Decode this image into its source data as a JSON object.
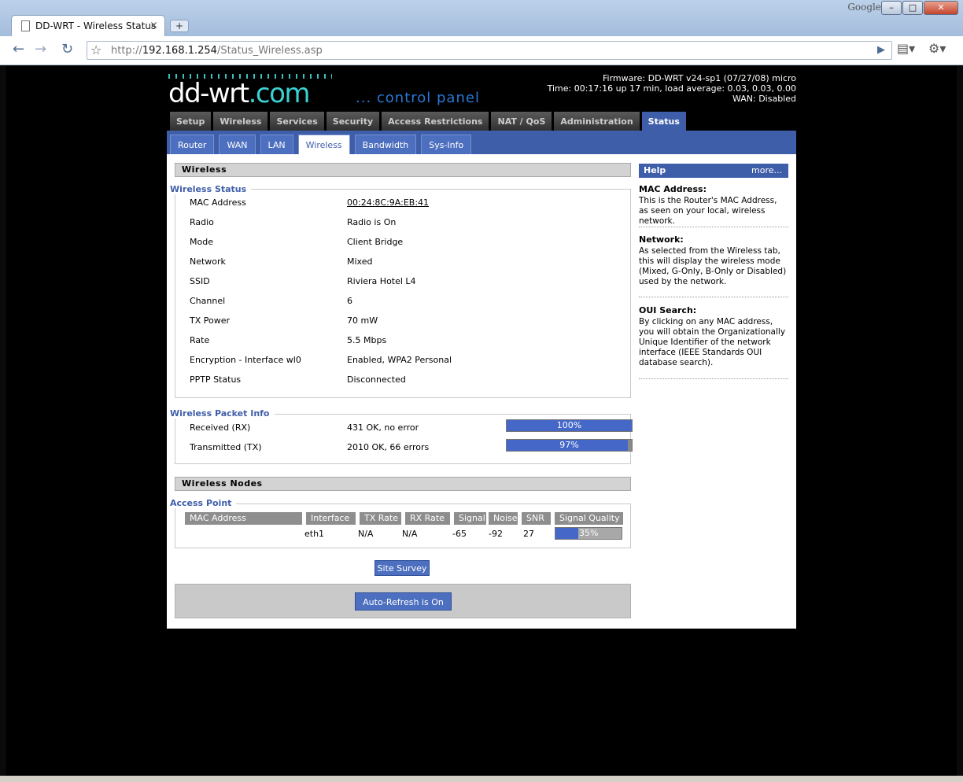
{
  "browser": {
    "tab_title": "DD-WRT - Wireless Status",
    "tab_close": "×",
    "new_tab": "+",
    "url_prefix": "http://",
    "url_host": "192.168.1.254",
    "url_path": "/Status_Wireless.asp",
    "google_label": "Google",
    "min": "–",
    "max": "□",
    "close": "✕"
  },
  "header": {
    "logo_a": "dd-wrt",
    "logo_b": ".com",
    "control_panel": "... control panel",
    "firmware": "Firmware: DD-WRT v24-sp1 (07/27/08) micro",
    "time": "Time: 00:17:16 up 17 min, load average: 0.03, 0.03, 0.00",
    "wan": "WAN: Disabled"
  },
  "mainnav": [
    "Setup",
    "Wireless",
    "Services",
    "Security",
    "Access Restrictions",
    "NAT / QoS",
    "Administration",
    "Status"
  ],
  "subnav": [
    "Router",
    "WAN",
    "LAN",
    "Wireless",
    "Bandwidth",
    "Sys-Info"
  ],
  "wireless": {
    "heading": "Wireless",
    "status_legend": "Wireless Status",
    "rows": [
      {
        "label": "MAC Address",
        "value": "00:24:8C:9A:EB:41"
      },
      {
        "label": "Radio",
        "value": "Radio is On"
      },
      {
        "label": "Mode",
        "value": "Client Bridge"
      },
      {
        "label": "Network",
        "value": "Mixed"
      },
      {
        "label": "SSID",
        "value": "Riviera Hotel L4"
      },
      {
        "label": "Channel",
        "value": "6"
      },
      {
        "label": "TX Power",
        "value": "70 mW"
      },
      {
        "label": "Rate",
        "value": "5.5 Mbps"
      },
      {
        "label": "Encryption - Interface wl0",
        "value": "Enabled, WPA2 Personal"
      },
      {
        "label": "PPTP Status",
        "value": "Disconnected"
      }
    ]
  },
  "packet_info": {
    "legend": "Wireless Packet Info",
    "rx": {
      "label": "Received (RX)",
      "value": "431 OK, no error",
      "percent": 100,
      "percent_label": "100%"
    },
    "tx": {
      "label": "Transmitted (TX)",
      "value": "2010 OK, 66 errors",
      "percent": 97,
      "percent_label": "97%"
    }
  },
  "nodes": {
    "heading": "Wireless Nodes",
    "legend": "Access Point",
    "columns": [
      "MAC Address",
      "Interface",
      "TX Rate",
      "RX Rate",
      "Signal",
      "Noise",
      "SNR",
      "Signal Quality"
    ],
    "row": {
      "mac": "",
      "interface": "eth1",
      "tx_rate": "N/A",
      "rx_rate": "N/A",
      "signal": "-65",
      "noise": "-92",
      "snr": "27",
      "quality": 35,
      "quality_label": "35%"
    }
  },
  "buttons": {
    "site_survey": "Site Survey",
    "auto_refresh": "Auto-Refresh is On"
  },
  "help": {
    "title": "Help",
    "more": "more...",
    "topics": [
      {
        "title": "MAC Address:",
        "desc": "This is the Router's MAC Address, as seen on your local, wireless network."
      },
      {
        "title": "Network:",
        "desc": "As selected from the Wireless tab, this will display the wireless mode (Mixed, G-Only, B-Only or Disabled) used by the network."
      },
      {
        "title": "OUI Search:",
        "desc": "By clicking on any MAC address, you will obtain the Organizationally Unique Identifier of the network interface (IEEE Standards OUI database search)."
      }
    ]
  },
  "colors": {
    "accent": "#3f5ea9",
    "meter": "#4568c8"
  }
}
